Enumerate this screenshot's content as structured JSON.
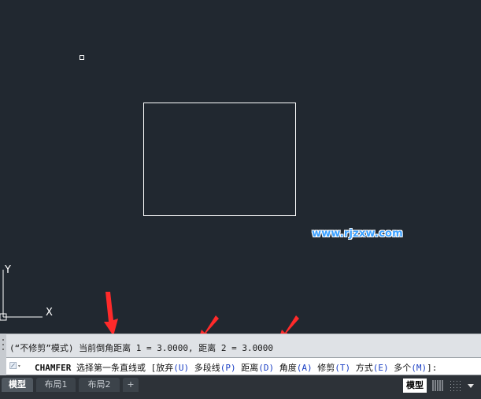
{
  "canvas": {
    "ucs_y_label": "Y",
    "ucs_x_label": "X",
    "watermark": "www.rjzxw.com",
    "background_color": "#212830"
  },
  "command_history": {
    "text": "(“不修剪”模式) 当前倒角距离 1 = 3.0000, 距离 2 = 3.0000"
  },
  "command_line": {
    "command": "CHAMFER",
    "prompt": " 选择第一条直线或 [",
    "options": [
      {
        "label": "放弃",
        "key": "(U)"
      },
      {
        "label": "多段线",
        "key": "(P)"
      },
      {
        "label": "距离",
        "key": "(D)"
      },
      {
        "label": "角度",
        "key": "(A)"
      },
      {
        "label": "修剪",
        "key": "(T)"
      },
      {
        "label": "方式",
        "key": "(E)"
      },
      {
        "label": "多个",
        "key": "(M)"
      }
    ],
    "suffix": "]:"
  },
  "tabs": [
    {
      "label": "模型",
      "active": true
    },
    {
      "label": "布局1",
      "active": false
    },
    {
      "label": "布局2",
      "active": false
    },
    {
      "label": "+",
      "active": false
    }
  ],
  "status_bar": {
    "model_label": "模型"
  },
  "icons": {
    "command_icon": "command-prompt-icon",
    "grid": "grid-icon",
    "snap": "snap-icon",
    "dropdown": "chevron-down-icon"
  },
  "colors": {
    "annotation_arrow": "#ff2a2a",
    "option_key": "#1a3fc4"
  }
}
